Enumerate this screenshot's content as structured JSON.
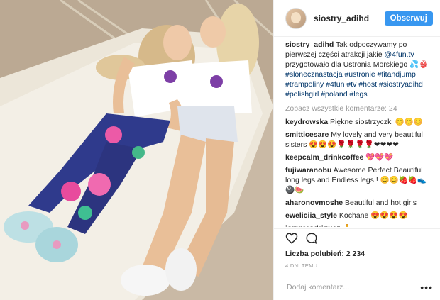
{
  "post": {
    "username": "siostry_adihd",
    "follow_label": "Obserwuj",
    "caption_text": " Tak odpoczywamy po pierwszej części atrakcji jakie ",
    "caption_mention": "@4fun.tv",
    "caption_text2": " przygotowało dla Ustronia Morskiego 💦👙 ",
    "caption_tags": "#slonecznastacja #ustronie #fitandjump #trampoliny #4fun #tv #host #siostryadihd #polishgirl #poland #legs",
    "view_all": "Zobacz wszystkie komentarze: 24",
    "comments": [
      {
        "user": "keydrowska",
        "text": " Piękne siostrzyczki 😊😊😊"
      },
      {
        "user": "smitticesare",
        "text": " My lovely and very beautiful sisters 😍😍😍🌹🌹🌹🌹❤❤❤❤"
      },
      {
        "user": "keepcalm_drinkcoffee",
        "text": " 💖💖💖"
      },
      {
        "user": "fujiwaranobu",
        "text": " Awesome Perfect Beautiful long legs and Endless legs ! 😊😊🍓🍓👟🎱🍉"
      },
      {
        "user": "aharonovmoshe",
        "text": " Beautiful and hot girls"
      },
      {
        "user": "eweliciia_style",
        "text": " Kochane 😍😍😍😍"
      },
      {
        "user": "jorrgerodriguez",
        "text": " 🙏"
      }
    ],
    "likes": "Liczba polubień: 2 234",
    "time_ago": "4 DNI TEMU",
    "add_comment_placeholder": "Dodaj komentarz...",
    "more_label": "•••"
  },
  "icons": {
    "like": "heart-icon",
    "comment": "speech-bubble-icon",
    "more": "ellipsis-icon"
  },
  "colors": {
    "follow_button": "#3897f0",
    "link": "#003569",
    "muted": "#999999"
  }
}
